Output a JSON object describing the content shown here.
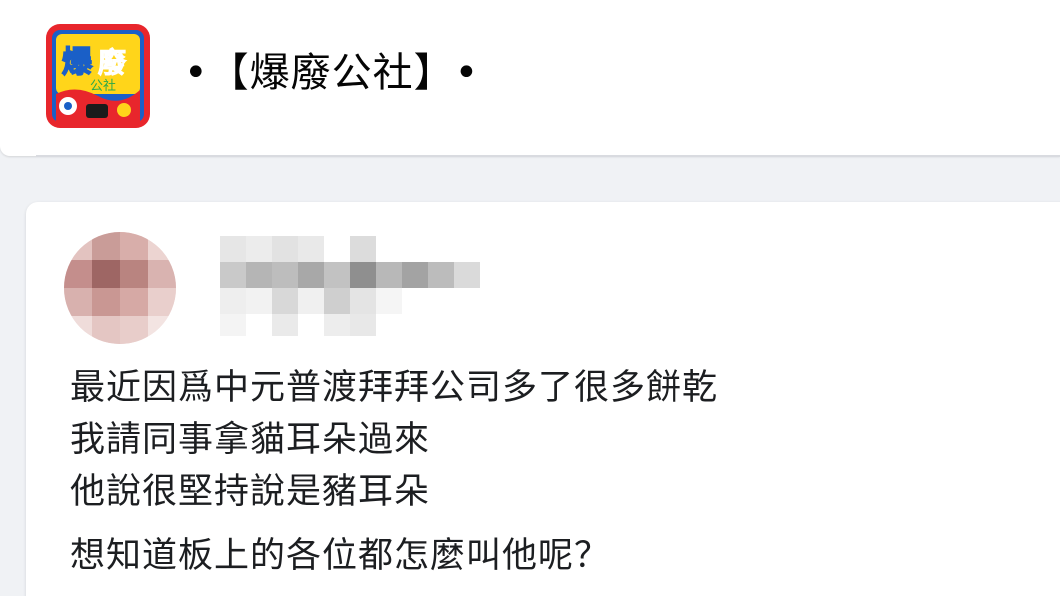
{
  "group": {
    "name": "•【爆廢公社】•",
    "logo_text": "爆廢公社"
  },
  "post": {
    "lines": [
      "最近因爲中元普渡拜拜公司多了很多餅乾",
      "我請同事拿貓耳朵過來",
      "他說很堅持說是豬耳朵"
    ],
    "question": "想知道板上的各位都怎麼叫他呢？"
  },
  "colors": {
    "page_background": "#f0f2f5",
    "card_background": "#ffffff",
    "text": "#1c1e21",
    "logo_red": "#e8262c",
    "logo_yellow": "#ffd51a",
    "logo_blue": "#1a5fc7"
  },
  "icons": {
    "group_logo": "group-logo-icon",
    "author_avatar": "blurred-avatar-icon",
    "author_name": "blurred-name-icon"
  }
}
